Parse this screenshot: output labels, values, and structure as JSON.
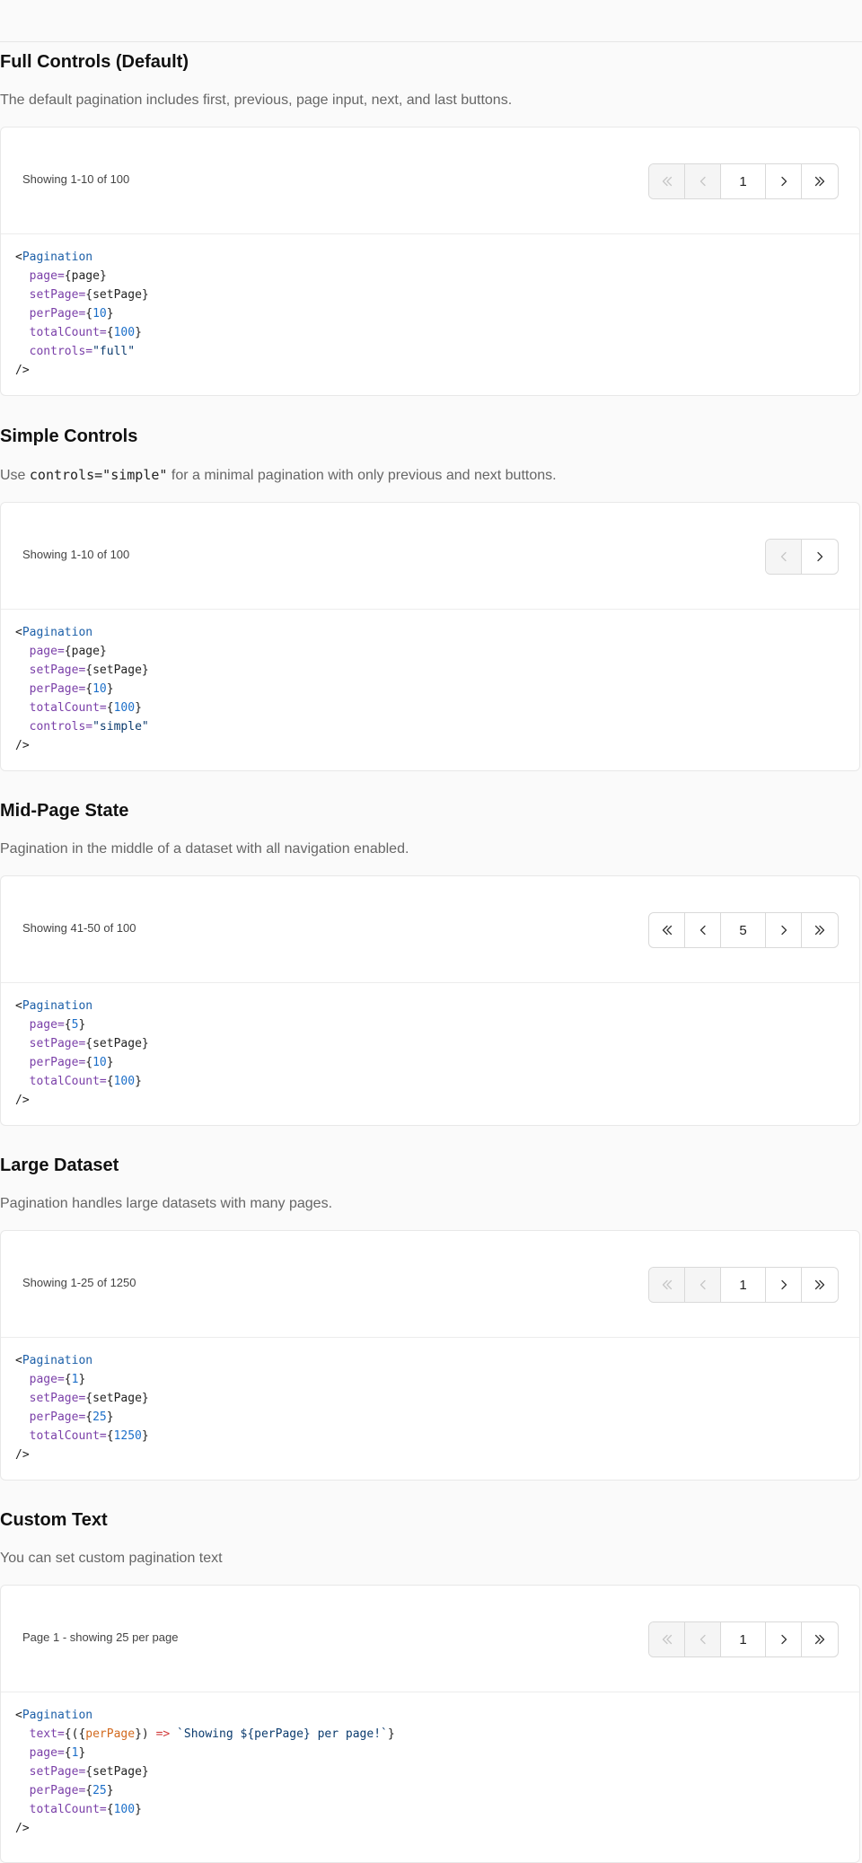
{
  "sections": [
    {
      "title": "Full Controls (Default)",
      "description": "The default pagination includes first, previous, page input, next, and last buttons.",
      "status_text": "Showing 1-10 of 100",
      "page_value": "1",
      "code": {
        "tag": "Pagination",
        "page": "page",
        "setPage": "setPage",
        "perPage": "10",
        "totalCount": "100",
        "controls": "\"full\""
      }
    },
    {
      "title": "Simple Controls",
      "description_before": "Use ",
      "description_code": "controls=\"simple\"",
      "description_after": " for a minimal pagination with only previous and next buttons.",
      "status_text": "Showing 1-10 of 100",
      "code": {
        "tag": "Pagination",
        "page": "page",
        "setPage": "setPage",
        "perPage": "10",
        "totalCount": "100",
        "controls": "\"simple\""
      }
    },
    {
      "title": "Mid-Page State",
      "description": "Pagination in the middle of a dataset with all navigation enabled.",
      "status_text": "Showing 41-50 of 100",
      "page_value": "5",
      "code": {
        "tag": "Pagination",
        "page": "5",
        "setPage": "setPage",
        "perPage": "10",
        "totalCount": "100"
      }
    },
    {
      "title": "Large Dataset",
      "description": "Pagination handles large datasets with many pages.",
      "status_text": "Showing 1-25 of 1250",
      "page_value": "1",
      "code": {
        "tag": "Pagination",
        "page": "1",
        "setPage": "setPage",
        "perPage": "25",
        "totalCount": "1250"
      }
    },
    {
      "title": "Custom Text",
      "description": "You can set custom pagination text",
      "status_text": "Page 1 - showing 25 per page",
      "page_value": "1",
      "code": {
        "tag": "Pagination",
        "text_param": "perPage",
        "text_template": "`Showing ${perPage} per page!`",
        "page": "1",
        "setPage": "setPage",
        "perPage": "25",
        "totalCount": "100"
      }
    }
  ],
  "code_tokens": {
    "open_angle": "<",
    "close": "/>",
    "page_attr": "page=",
    "setPage_attr": "setPage=",
    "perPage_attr": "perPage=",
    "totalCount_attr": "totalCount=",
    "controls_attr": "controls=",
    "text_attr": "text=",
    "arrow": "=>",
    "lbrace": "{",
    "rbrace": "}"
  },
  "icons": {
    "first": "chevrons-left-icon",
    "prev": "chevron-left-icon",
    "next": "chevron-right-icon",
    "last": "chevrons-right-icon"
  },
  "colors": {
    "tag": "#1c5fa8",
    "attr": "#7a3fa8",
    "number": "#1c6fc9",
    "string": "#0b3b6e",
    "param": "#d26a1f",
    "arrow": "#d23b3b"
  }
}
